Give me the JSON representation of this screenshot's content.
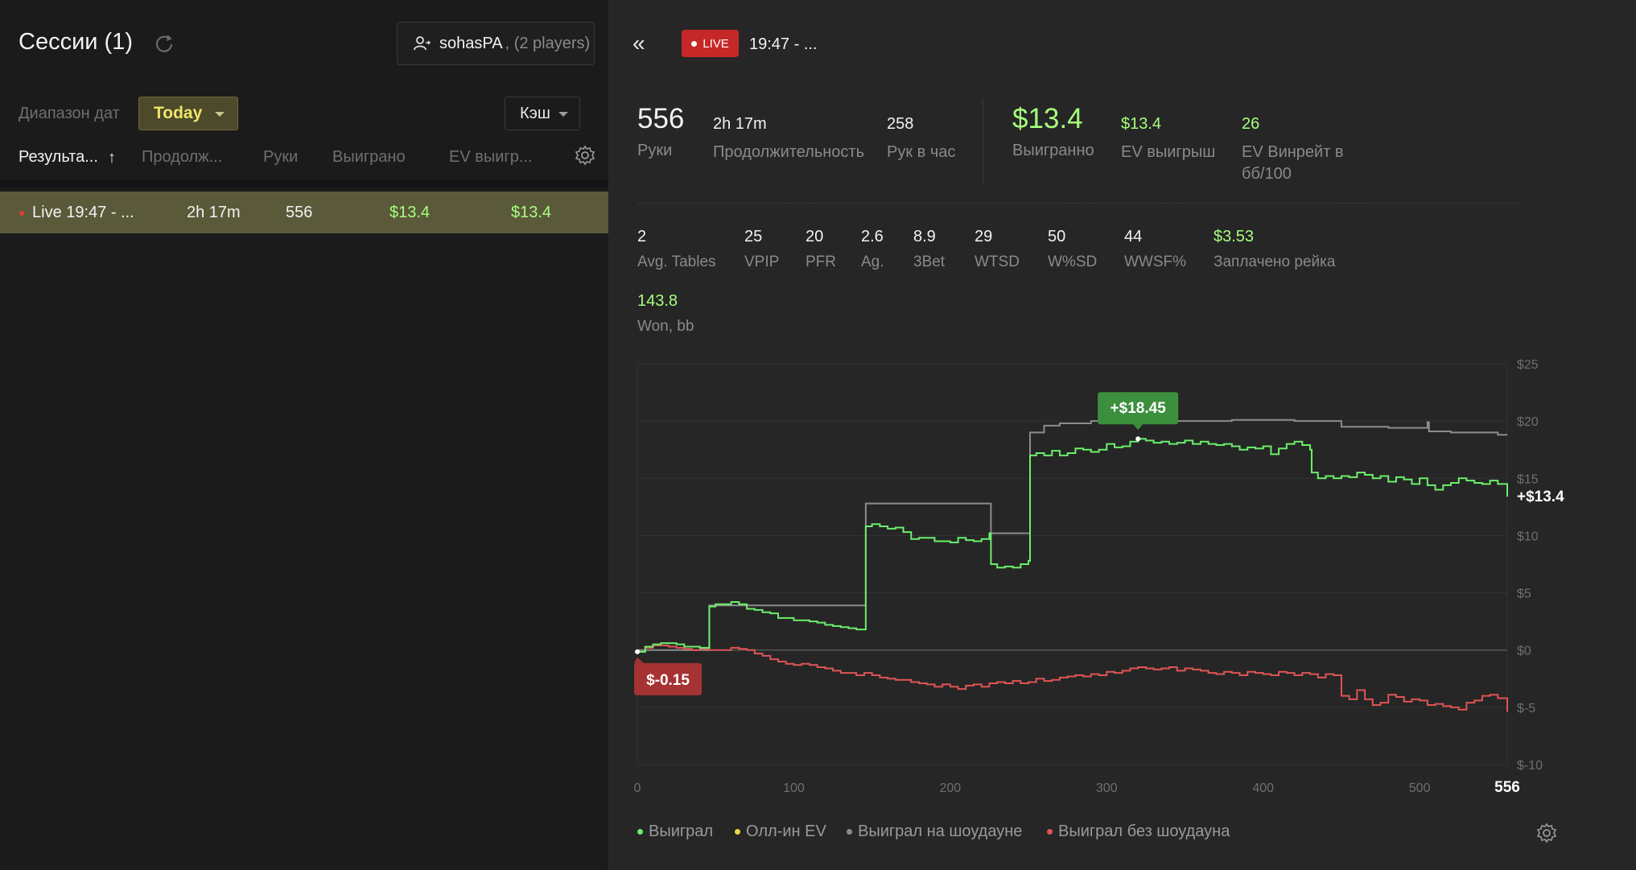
{
  "left": {
    "title": "Сессии (1)",
    "player": {
      "name": "sohasPA",
      "sub": ", (2 players)"
    },
    "date_label": "Диапазон дат",
    "date_value": "Today",
    "game_type": "Кэш",
    "columns": [
      "Результа...",
      "Продолж...",
      "Руки",
      "Выиграно",
      "EV выигр..."
    ],
    "sort_arrow": "↑",
    "rows": [
      {
        "name": "Live 19:47 - ...",
        "duration": "2h 17m",
        "hands": "556",
        "won": "$13.4",
        "ev": "$13.4"
      }
    ]
  },
  "right": {
    "live_label": "LIVE",
    "session_title": "19:47 - ...",
    "stats_top": [
      {
        "value": "556",
        "label": "Руки"
      },
      {
        "value": "2h 17m",
        "label": "Продолжительность"
      },
      {
        "value": "258",
        "label": "Рук в час"
      },
      {
        "value": "$13.4",
        "label": "Выигранно"
      },
      {
        "value": "$13.4",
        "label": "EV выигрыш"
      },
      {
        "value": "26",
        "label": "EV Винрейт в бб/100"
      }
    ],
    "stats_mid": [
      {
        "value": "2",
        "label": "Avg. Tables"
      },
      {
        "value": "25",
        "label": "VPIP"
      },
      {
        "value": "20",
        "label": "PFR"
      },
      {
        "value": "2.6",
        "label": "Ag."
      },
      {
        "value": "8.9",
        "label": "3Bet"
      },
      {
        "value": "29",
        "label": "WTSD"
      },
      {
        "value": "50",
        "label": "W%SD"
      },
      {
        "value": "44",
        "label": "WWSF%"
      },
      {
        "value": "$3.53",
        "label": "Заплачено рейка"
      }
    ],
    "stats_bottom": [
      {
        "value": "143.8",
        "label": "Won, bb"
      }
    ]
  },
  "chart_data": {
    "type": "line",
    "x_ticks": [
      0,
      100,
      200,
      300,
      400,
      500
    ],
    "x_end_label": "556",
    "xlim": [
      0,
      556
    ],
    "ylim": [
      -10,
      25
    ],
    "y_ticks": [
      "$25",
      "$20",
      "$15",
      "$10",
      "$5",
      "$0",
      "$-5",
      "$-10"
    ],
    "y_tick_values": [
      25,
      20,
      15,
      10,
      5,
      0,
      -5,
      -10
    ],
    "annotations": {
      "max": "+$18.45",
      "min": "$-0.15",
      "last": "+$13.4"
    },
    "colors": {
      "won": "#6bef6b",
      "showdown": "#8c8c8c",
      "nonshowdown": "#e05454",
      "allin": "#e6d84a",
      "grid": "#333333"
    },
    "series": [
      {
        "name": "Выиграл",
        "x": [
          0,
          5,
          10,
          15,
          20,
          25,
          30,
          35,
          40,
          45,
          46,
          50,
          55,
          60,
          65,
          70,
          75,
          80,
          85,
          90,
          95,
          100,
          105,
          110,
          115,
          120,
          125,
          130,
          135,
          140,
          145,
          146,
          150,
          155,
          160,
          165,
          170,
          175,
          180,
          185,
          190,
          195,
          200,
          205,
          210,
          215,
          220,
          225,
          226,
          230,
          235,
          240,
          245,
          250,
          251,
          255,
          260,
          265,
          270,
          275,
          280,
          285,
          290,
          295,
          300,
          305,
          310,
          315,
          320,
          325,
          330,
          335,
          340,
          345,
          350,
          355,
          360,
          365,
          370,
          375,
          380,
          385,
          390,
          395,
          400,
          405,
          410,
          415,
          420,
          425,
          430,
          431,
          435,
          440,
          445,
          450,
          455,
          460,
          465,
          470,
          475,
          480,
          485,
          490,
          495,
          500,
          505,
          510,
          515,
          520,
          525,
          530,
          535,
          540,
          545,
          550,
          556
        ],
        "y": [
          -0.15,
          0.3,
          0.5,
          0.6,
          0.6,
          0.5,
          0.3,
          0.3,
          0.2,
          0.2,
          3.8,
          4.0,
          4.0,
          4.2,
          4.0,
          3.6,
          3.5,
          3.3,
          3.2,
          2.8,
          2.8,
          2.6,
          2.6,
          2.5,
          2.4,
          2.2,
          2.1,
          2.0,
          1.9,
          1.8,
          1.8,
          10.8,
          11.0,
          10.8,
          10.6,
          10.7,
          10.3,
          9.7,
          9.8,
          9.8,
          9.5,
          9.5,
          9.4,
          9.8,
          9.6,
          9.5,
          9.7,
          10.2,
          7.5,
          7.2,
          7.3,
          7.2,
          7.5,
          7.8,
          17.0,
          17.2,
          17.0,
          17.4,
          17.0,
          17.2,
          17.6,
          17.5,
          17.3,
          17.5,
          18.0,
          17.7,
          17.8,
          18.2,
          18.45,
          18.3,
          18.1,
          18.2,
          18.0,
          18.1,
          18.3,
          18.0,
          18.2,
          18.0,
          17.9,
          18.0,
          17.8,
          17.5,
          17.7,
          17.6,
          17.8,
          17.1,
          17.6,
          18.0,
          18.2,
          17.9,
          17.5,
          15.5,
          15.0,
          15.2,
          15.0,
          15.2,
          15.1,
          15.5,
          15.3,
          15.0,
          15.2,
          14.7,
          15.1,
          14.9,
          14.5,
          15.0,
          14.4,
          14.0,
          14.4,
          14.6,
          15.0,
          14.8,
          14.6,
          14.5,
          14.8,
          14.5,
          13.4
        ]
      },
      {
        "name": "Выиграл на шоудауне",
        "x": [
          0,
          45,
          46,
          145,
          146,
          225,
          226,
          250,
          251,
          255,
          260,
          265,
          270,
          280,
          290,
          300,
          305,
          315,
          320,
          340,
          350,
          380,
          400,
          420,
          430,
          440,
          445,
          450,
          455,
          460,
          480,
          500,
          505,
          506,
          510,
          520,
          550,
          556
        ],
        "y": [
          0,
          0,
          3.9,
          3.9,
          12.8,
          12.8,
          10.2,
          10.2,
          19.0,
          19.0,
          19.6,
          19.6,
          19.8,
          19.8,
          20.0,
          19.8,
          20.0,
          20.0,
          20.1,
          20.0,
          20.0,
          20.1,
          20.1,
          20.0,
          20.0,
          20.0,
          20.0,
          19.5,
          19.5,
          19.5,
          19.4,
          19.4,
          19.9,
          19.1,
          19.1,
          19.0,
          18.8,
          18.8
        ]
      },
      {
        "name": "Выиграл без шоудауна",
        "x": [
          0,
          5,
          10,
          15,
          20,
          25,
          30,
          35,
          40,
          45,
          50,
          55,
          60,
          65,
          70,
          75,
          80,
          85,
          90,
          95,
          100,
          105,
          110,
          115,
          120,
          125,
          130,
          135,
          140,
          145,
          150,
          155,
          160,
          165,
          170,
          175,
          180,
          185,
          190,
          195,
          200,
          205,
          210,
          215,
          220,
          225,
          230,
          235,
          240,
          245,
          250,
          255,
          260,
          265,
          270,
          275,
          280,
          285,
          290,
          295,
          300,
          305,
          310,
          315,
          320,
          325,
          330,
          335,
          340,
          345,
          350,
          355,
          360,
          365,
          370,
          375,
          380,
          385,
          390,
          395,
          400,
          405,
          410,
          415,
          420,
          425,
          430,
          435,
          440,
          445,
          450,
          455,
          460,
          465,
          470,
          475,
          480,
          485,
          490,
          495,
          500,
          505,
          510,
          515,
          520,
          525,
          530,
          535,
          540,
          545,
          550,
          556
        ],
        "y": [
          -0.15,
          0.2,
          0.4,
          0.4,
          0.3,
          0.2,
          0.1,
          0.0,
          0.1,
          0.0,
          0.0,
          0.0,
          0.2,
          0.1,
          0.0,
          -0.3,
          -0.5,
          -0.8,
          -1.0,
          -1.2,
          -1.3,
          -1.2,
          -1.3,
          -1.5,
          -1.6,
          -1.8,
          -2.0,
          -2.0,
          -2.2,
          -2.0,
          -2.2,
          -2.4,
          -2.5,
          -2.6,
          -2.6,
          -2.8,
          -2.9,
          -3.0,
          -3.2,
          -3.0,
          -3.2,
          -3.4,
          -3.1,
          -3.0,
          -3.2,
          -2.9,
          -2.8,
          -2.9,
          -2.7,
          -2.9,
          -2.8,
          -2.5,
          -2.7,
          -2.6,
          -2.4,
          -2.3,
          -2.2,
          -2.3,
          -2.1,
          -2.2,
          -1.9,
          -2.0,
          -1.8,
          -1.6,
          -1.5,
          -1.6,
          -1.7,
          -1.6,
          -1.5,
          -1.8,
          -1.6,
          -1.7,
          -1.8,
          -2.0,
          -2.1,
          -1.9,
          -2.0,
          -2.2,
          -1.9,
          -2.0,
          -2.1,
          -2.2,
          -1.9,
          -2.0,
          -2.2,
          -2.0,
          -2.1,
          -2.4,
          -2.1,
          -2.2,
          -4.0,
          -4.3,
          -3.5,
          -4.3,
          -4.8,
          -4.6,
          -3.9,
          -4.1,
          -4.5,
          -4.3,
          -4.4,
          -4.8,
          -4.7,
          -4.9,
          -5.0,
          -5.2,
          -4.6,
          -4.4,
          -4.0,
          -3.9,
          -4.2,
          -5.4
        ]
      },
      {
        "name": "Олл-ин EV",
        "x": [],
        "y": []
      }
    ],
    "legend": [
      "Выиграл",
      "Олл-ин EV",
      "Выиграл на шоудауне",
      "Выиграл без шоудауна"
    ],
    "legend_placement": "bottom-left",
    "grid": true
  }
}
